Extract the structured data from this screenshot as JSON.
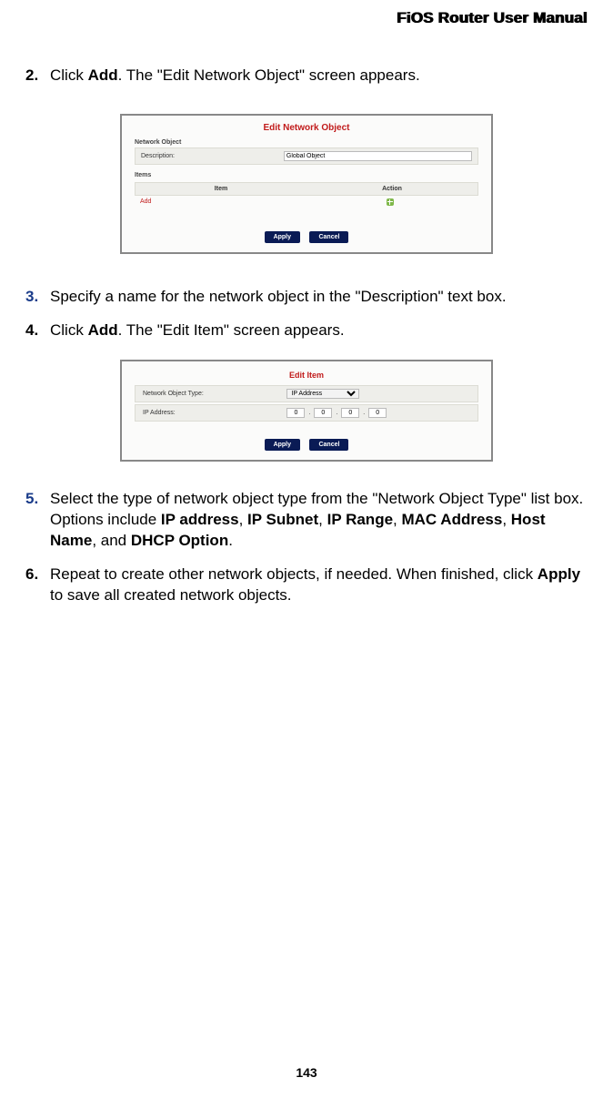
{
  "header": {
    "title": "FiOS Router User Manual"
  },
  "steps": {
    "s2": {
      "num": "2.",
      "pre": "Click ",
      "bold": "Add",
      "post": ". The \"Edit Network Object\" screen appears."
    },
    "s3": {
      "num": "3.",
      "text": "Specify a name for the network object in the \"Description\" text box."
    },
    "s4": {
      "num": "4.",
      "pre": "Click ",
      "bold": "Add",
      "post": ". The \"Edit Item\" screen appears."
    },
    "s5": {
      "num": "5.",
      "pre": "Select the type of network object type from the \"Network Object Type\" list box. Options include ",
      "b1": "IP address",
      "b2": "IP Subnet",
      "b3": "IP Range",
      "b4": "MAC Address",
      "b5": "Host Name",
      "b6": "DHCP Option",
      "sep": ", ",
      "and": ", and ",
      "end": "."
    },
    "s6": {
      "num": "6.",
      "pre": "Repeat to create other network objects, if needed. When finished, click ",
      "bold": "Apply",
      "post": " to save all created network objects."
    }
  },
  "fig1": {
    "title": "Edit Network Object",
    "sec1": "Network Object",
    "desc_label": "Description:",
    "desc_value": "Global Object",
    "sec2": "Items",
    "th1": "Item",
    "th2": "Action",
    "add": "Add",
    "btn_apply": "Apply",
    "btn_cancel": "Cancel"
  },
  "fig2": {
    "title": "Edit Item",
    "type_label": "Network Object Type:",
    "type_value": "IP Address",
    "ip_label": "IP Address:",
    "oct1": "0",
    "oct2": "0",
    "oct3": "0",
    "oct4": "0",
    "btn_apply": "Apply",
    "btn_cancel": "Cancel"
  },
  "page": {
    "number": "143"
  }
}
